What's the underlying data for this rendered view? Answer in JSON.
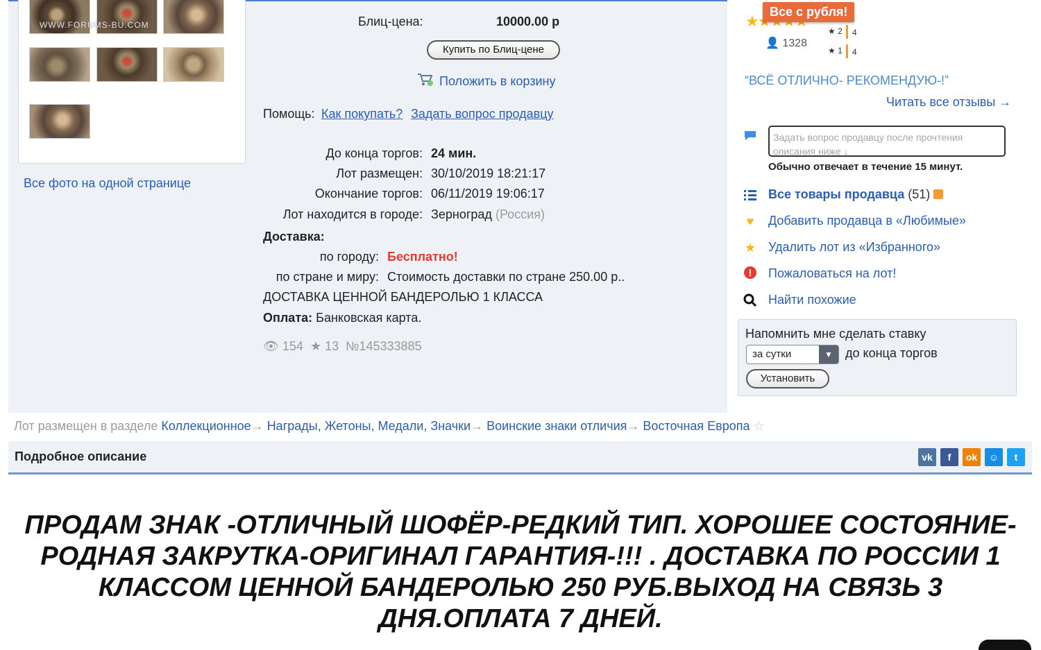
{
  "gallery": {
    "watermark": "WWW.FORUMS-BU.COM",
    "all_photos_link": "Все фото на одной странице"
  },
  "purchase": {
    "blitz_label": "Блиц-цена:",
    "blitz_value": "10000.00 р",
    "buy_button": "Купить по Блиц-цене",
    "cart_link": "Положить в корзину",
    "help_label": "Помощь:",
    "help_links": [
      "Как покупать?",
      "Задать вопрос продавцу"
    ]
  },
  "lot": {
    "rows": [
      {
        "label": "До конца торгов:",
        "value": "24 мин."
      },
      {
        "label": "Лот размещен:",
        "value": "30/10/2019 18:21:17"
      },
      {
        "label": "Окончание торгов:",
        "value": "06/11/2019 19:06:17"
      },
      {
        "label": "Лот находится в городе:",
        "value": "Зерноград"
      }
    ],
    "country": "(Россия)",
    "delivery_title": "Доставка:",
    "city_label": "по городу:",
    "city_value": "Бесплатно!",
    "world_label": "по стране и миру:",
    "world_value": "Стоимость доставки по стране 250.00 р..",
    "delivery_note": "ДОСТАВКА ЦЕННОЙ БАНДЕРОЛЬЮ 1 КЛАССА",
    "payment_label": "Оплата:",
    "payment_value": "Банковская карта.",
    "views": "154",
    "favorites": "13",
    "number": "№145333885"
  },
  "seller": {
    "badge": "Все с рубля!",
    "rating_count": "1328",
    "rating_rows": [
      {
        "stars": "★ 2",
        "count": "4"
      },
      {
        "stars": "★ 1",
        "count": "4"
      }
    ],
    "review_quote": "“ВСЁ ОТЛИЧНО- РЕКОМЕНДУЮ-!”",
    "read_reviews": "Читать все отзывы →",
    "question_placeholder": "Задать вопрос продавцу после прочтения описания ниже ↓",
    "answer_note": "Обычно отвечает в течение 15 минут.",
    "all_items": "Все товары продавца",
    "all_items_count": "(51)",
    "links": [
      "Добавить продавца в «Любимые»",
      "Удалить лот из «Избранного»",
      "Пожаловаться на лот!",
      "Найти похожие"
    ]
  },
  "reminder": {
    "title": "Напомнить мне сделать ставку",
    "period": "за сутки",
    "suffix": "до конца торгов",
    "button": "Установить"
  },
  "breadcrumb": {
    "prefix": "Лот размещен в разделе",
    "items": [
      "Коллекционное",
      "Награды, Жетоны, Медали, Значки",
      "Воинские знаки отличия",
      "Восточная Европа"
    ]
  },
  "description": {
    "title": "Подробное описание",
    "text": "ПРОДАМ ЗНАК -ОТЛИЧНЫЙ ШОФЁР-РЕДКИЙ ТИП. ХОРОШЕЕ СОСТОЯНИЕ-РОДНАЯ ЗАКРУТКА-ОРИГИНАЛ ГАРАНТИЯ-!!! . ДОСТАВКА ПО РОССИИ 1 КЛАССОМ ЦЕННОЙ БАНДЕРОЛЬЮ 250 РУБ.ВЫХОД НА СВЯЗЬ 3 ДНЯ.ОПЛАТА 7 ДНЕЙ."
  },
  "colors": {
    "accent": "#2a5db8",
    "panel": "#eef1f6",
    "badge": "#e86b3c",
    "star": "#f6b917",
    "alert": "#e53a2f"
  },
  "icons": [
    "cart-icon",
    "eye-icon",
    "star-icon",
    "chat-icon",
    "list-icon",
    "heart-icon",
    "alert-icon",
    "search-icon",
    "rss-icon",
    "vk-icon",
    "facebook-icon",
    "odnoklassniki-icon",
    "mail-icon",
    "twitter-icon"
  ]
}
